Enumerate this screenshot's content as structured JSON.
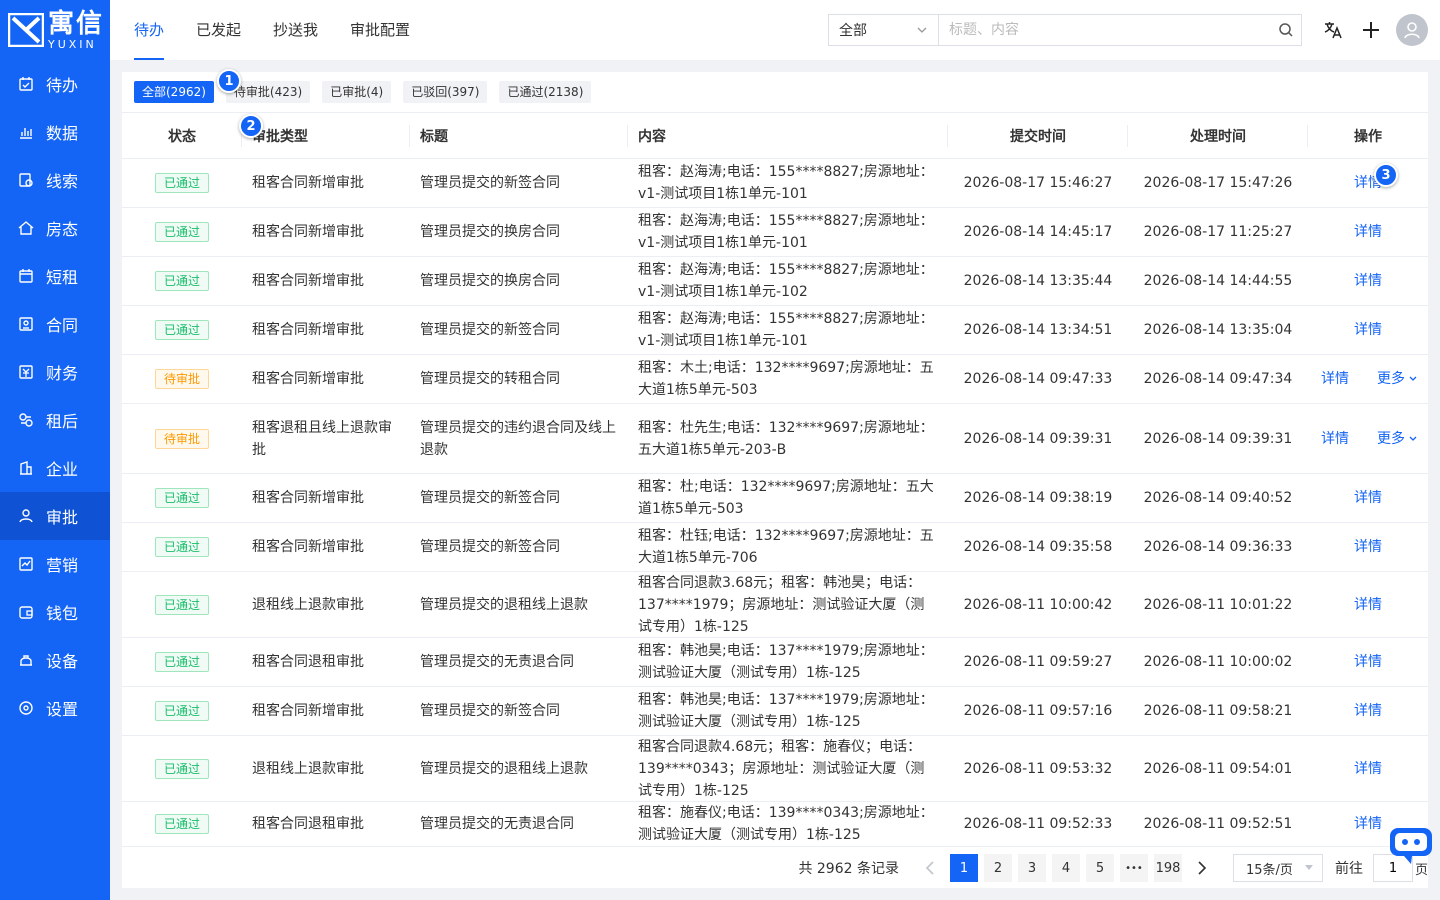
{
  "brand": {
    "cn": "寓信",
    "en": "YUXIN"
  },
  "colors": {
    "primary": "#1464f5",
    "pass": "#19be6b",
    "wait": "#ff9900"
  },
  "sidebar": {
    "items": [
      {
        "label": "待办",
        "icon": "todo-icon"
      },
      {
        "label": "数据",
        "icon": "chart-icon"
      },
      {
        "label": "线索",
        "icon": "clue-icon"
      },
      {
        "label": "房态",
        "icon": "house-icon"
      },
      {
        "label": "短租",
        "icon": "calendar-icon"
      },
      {
        "label": "合同",
        "icon": "contract-icon"
      },
      {
        "label": "财务",
        "icon": "finance-icon"
      },
      {
        "label": "租后",
        "icon": "service-icon"
      },
      {
        "label": "企业",
        "icon": "building-icon"
      },
      {
        "label": "审批",
        "icon": "user-icon"
      },
      {
        "label": "营销",
        "icon": "marketing-icon"
      },
      {
        "label": "钱包",
        "icon": "wallet-icon"
      },
      {
        "label": "设备",
        "icon": "device-icon"
      },
      {
        "label": "设置",
        "icon": "settings-icon"
      }
    ]
  },
  "top_tabs": [
    "待办",
    "已发起",
    "抄送我",
    "审批配置"
  ],
  "search": {
    "scope": "全部",
    "placeholder": "标题、内容"
  },
  "filters": [
    "全部(2962)",
    "待审批(423)",
    "已审批(4)",
    "已驳回(397)",
    "已通过(2138)"
  ],
  "columns": [
    "状态",
    "审批类型",
    "标题",
    "内容",
    "提交时间",
    "处理时间",
    "操作"
  ],
  "rows": [
    {
      "status": "已通过",
      "status_kind": "pass",
      "type": "租客合同新增审批",
      "title": "管理员提交的新签合同",
      "content": "租客：赵海涛;电话：155****8827;房源地址：v1-测试项目1栋1单元-101",
      "submit": "2026-08-17 15:46:27",
      "handle": "2026-08-17 15:47:26",
      "op": "详情",
      "more": ""
    },
    {
      "status": "已通过",
      "status_kind": "pass",
      "type": "租客合同新增审批",
      "title": "管理员提交的换房合同",
      "content": "租客：赵海涛;电话：155****8827;房源地址：v1-测试项目1栋1单元-101",
      "submit": "2026-08-14 14:45:17",
      "handle": "2026-08-17 11:25:27",
      "op": "详情",
      "more": ""
    },
    {
      "status": "已通过",
      "status_kind": "pass",
      "type": "租客合同新增审批",
      "title": "管理员提交的换房合同",
      "content": "租客：赵海涛;电话：155****8827;房源地址：v1-测试项目1栋1单元-102",
      "submit": "2026-08-14 13:35:44",
      "handle": "2026-08-14 14:44:55",
      "op": "详情",
      "more": ""
    },
    {
      "status": "已通过",
      "status_kind": "pass",
      "type": "租客合同新增审批",
      "title": "管理员提交的新签合同",
      "content": "租客：赵海涛;电话：155****8827;房源地址：v1-测试项目1栋1单元-101",
      "submit": "2026-08-14 13:34:51",
      "handle": "2026-08-14 13:35:04",
      "op": "详情",
      "more": ""
    },
    {
      "status": "待审批",
      "status_kind": "wait",
      "type": "租客合同新增审批",
      "title": "管理员提交的转租合同",
      "content": "租客：木土;电话：132****9697;房源地址：五大道1栋5单元-503",
      "submit": "2026-08-14 09:47:33",
      "handle": "2026-08-14 09:47:34",
      "op": "详情",
      "more": "更多"
    },
    {
      "status": "待审批",
      "status_kind": "wait",
      "type": "租客退租且线上退款审批",
      "title": "管理员提交的违约退合同及线上退款",
      "content": "租客：杜先生;电话：132****9697;房源地址：五大道1栋5单元-203-B",
      "submit": "2026-08-14 09:39:31",
      "handle": "2026-08-14 09:39:31",
      "op": "详情",
      "more": "更多"
    },
    {
      "status": "已通过",
      "status_kind": "pass",
      "type": "租客合同新增审批",
      "title": "管理员提交的新签合同",
      "content": "租客：杜;电话：132****9697;房源地址：五大道1栋5单元-503",
      "submit": "2026-08-14 09:38:19",
      "handle": "2026-08-14 09:40:52",
      "op": "详情",
      "more": ""
    },
    {
      "status": "已通过",
      "status_kind": "pass",
      "type": "租客合同新增审批",
      "title": "管理员提交的新签合同",
      "content": "租客：杜钰;电话：132****9697;房源地址：五大道1栋5单元-706",
      "submit": "2026-08-14 09:35:58",
      "handle": "2026-08-14 09:36:33",
      "op": "详情",
      "more": ""
    },
    {
      "status": "已通过",
      "status_kind": "pass",
      "type": "退租线上退款审批",
      "title": "管理员提交的退租线上退款",
      "content": "租客合同退款3.68元；租客：韩池昊；电话：137****1979；房源地址：测试验证大厦（测试专用）1栋-125",
      "submit": "2026-08-11 10:00:42",
      "handle": "2026-08-11 10:01:22",
      "op": "详情",
      "more": ""
    },
    {
      "status": "已通过",
      "status_kind": "pass",
      "type": "租客合同退租审批",
      "title": "管理员提交的无责退合同",
      "content": "租客：韩池昊;电话：137****1979;房源地址：测试验证大厦（测试专用）1栋-125",
      "submit": "2026-08-11 09:59:27",
      "handle": "2026-08-11 10:00:02",
      "op": "详情",
      "more": ""
    },
    {
      "status": "已通过",
      "status_kind": "pass",
      "type": "租客合同新增审批",
      "title": "管理员提交的新签合同",
      "content": "租客：韩池昊;电话：137****1979;房源地址：测试验证大厦（测试专用）1栋-125",
      "submit": "2026-08-11 09:57:16",
      "handle": "2026-08-11 09:58:21",
      "op": "详情",
      "more": ""
    },
    {
      "status": "已通过",
      "status_kind": "pass",
      "type": "退租线上退款审批",
      "title": "管理员提交的退租线上退款",
      "content": "租客合同退款4.68元；租客：施春仪；电话：139****0343；房源地址：测试验证大厦（测试专用）1栋-125",
      "submit": "2026-08-11 09:53:32",
      "handle": "2026-08-11 09:54:01",
      "op": "详情",
      "more": ""
    },
    {
      "status": "已通过",
      "status_kind": "pass",
      "type": "租客合同退租审批",
      "title": "管理员提交的无责退合同",
      "content": "租客：施春仪;电话：139****0343;房源地址：测试验证大厦（测试专用）1栋-125",
      "submit": "2026-08-11 09:52:33",
      "handle": "2026-08-11 09:52:51",
      "op": "详情",
      "more": ""
    }
  ],
  "pagination": {
    "total": "共 2962 条记录",
    "pages": [
      "1",
      "2",
      "3",
      "4",
      "5",
      "•••",
      "198"
    ],
    "current": "1",
    "page_size": "15条/页",
    "goto_label": "前往",
    "goto_value": "1",
    "goto_suffix": "页"
  },
  "markers": [
    "1",
    "2",
    "3"
  ]
}
